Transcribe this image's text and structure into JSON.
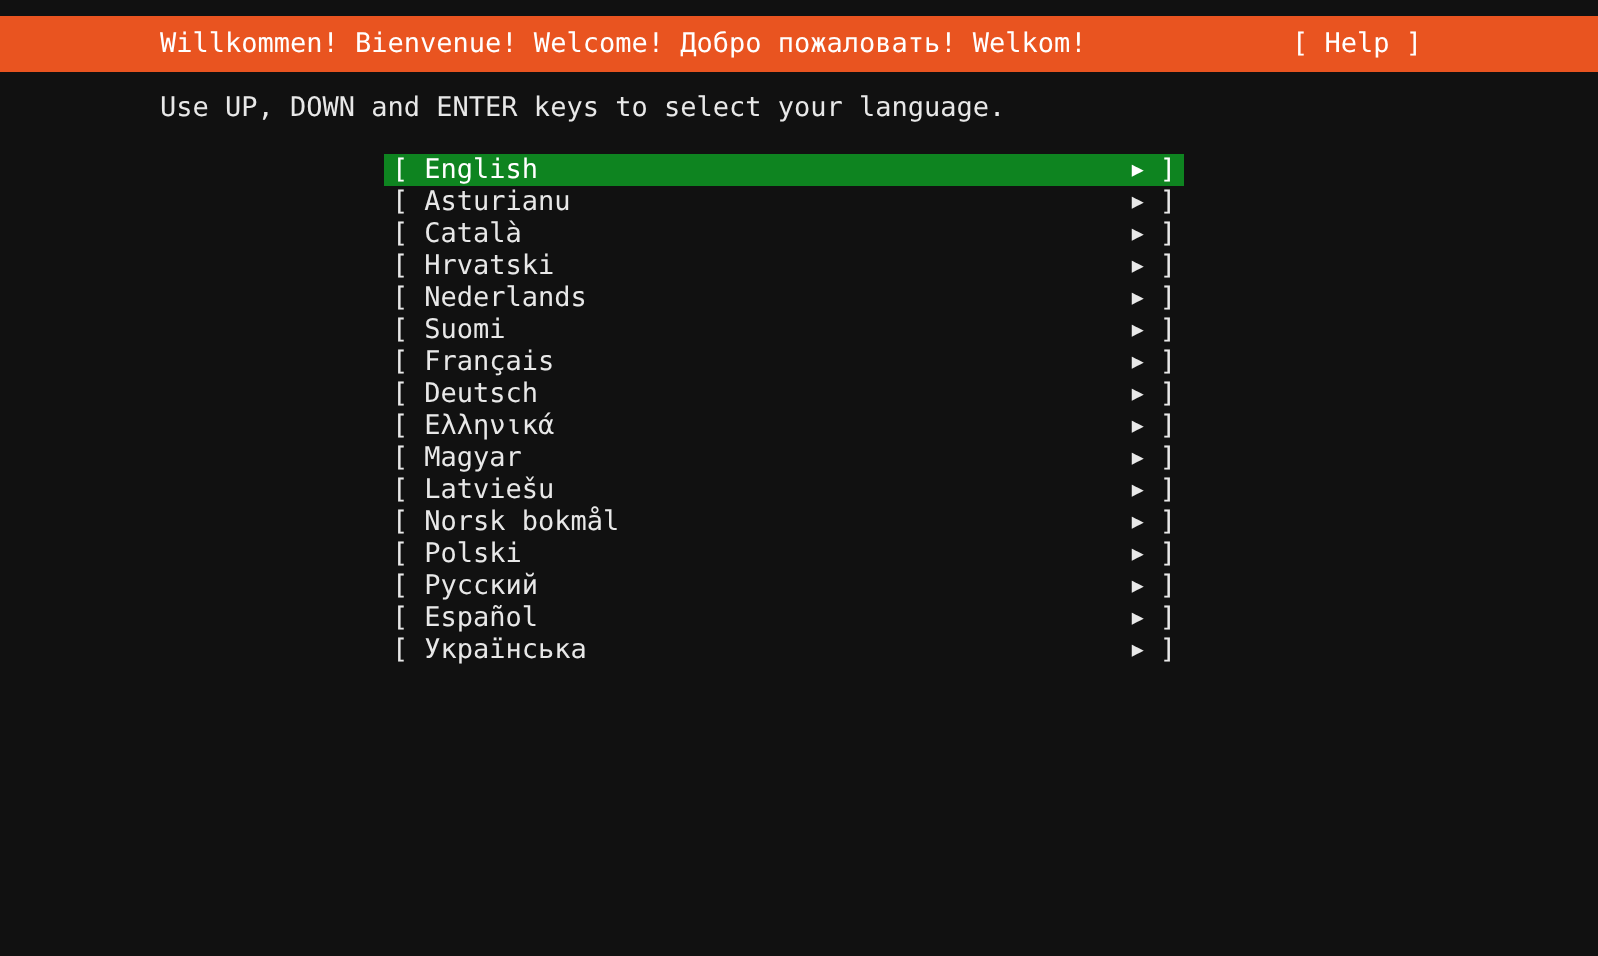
{
  "header": {
    "title": "Willkommen! Bienvenue! Welcome! Добро пожаловать! Welkom!",
    "help_button": "[ Help ]"
  },
  "instruction": "Use UP, DOWN and ENTER keys to select your language.",
  "languages": [
    {
      "open": "[",
      "label": "English",
      "arrow": "▶",
      "close": "]",
      "selected": true
    },
    {
      "open": "[",
      "label": "Asturianu",
      "arrow": "▶",
      "close": "]",
      "selected": false
    },
    {
      "open": "[",
      "label": "Català",
      "arrow": "▶",
      "close": "]",
      "selected": false
    },
    {
      "open": "[",
      "label": "Hrvatski",
      "arrow": "▶",
      "close": "]",
      "selected": false
    },
    {
      "open": "[",
      "label": "Nederlands",
      "arrow": "▶",
      "close": "]",
      "selected": false
    },
    {
      "open": "[",
      "label": "Suomi",
      "arrow": "▶",
      "close": "]",
      "selected": false
    },
    {
      "open": "[",
      "label": "Français",
      "arrow": "▶",
      "close": "]",
      "selected": false
    },
    {
      "open": "[",
      "label": "Deutsch",
      "arrow": "▶",
      "close": "]",
      "selected": false
    },
    {
      "open": "[",
      "label": "Ελληνικά",
      "arrow": "▶",
      "close": "]",
      "selected": false
    },
    {
      "open": "[",
      "label": "Magyar",
      "arrow": "▶",
      "close": "]",
      "selected": false
    },
    {
      "open": "[",
      "label": "Latviešu",
      "arrow": "▶",
      "close": "]",
      "selected": false
    },
    {
      "open": "[",
      "label": "Norsk bokmål",
      "arrow": "▶",
      "close": "]",
      "selected": false
    },
    {
      "open": "[",
      "label": "Polski",
      "arrow": "▶",
      "close": "]",
      "selected": false
    },
    {
      "open": "[",
      "label": "Русский",
      "arrow": "▶",
      "close": "]",
      "selected": false
    },
    {
      "open": "[",
      "label": "Español",
      "arrow": "▶",
      "close": "]",
      "selected": false
    },
    {
      "open": "[",
      "label": "Українська",
      "arrow": "▶",
      "close": "]",
      "selected": false
    }
  ]
}
